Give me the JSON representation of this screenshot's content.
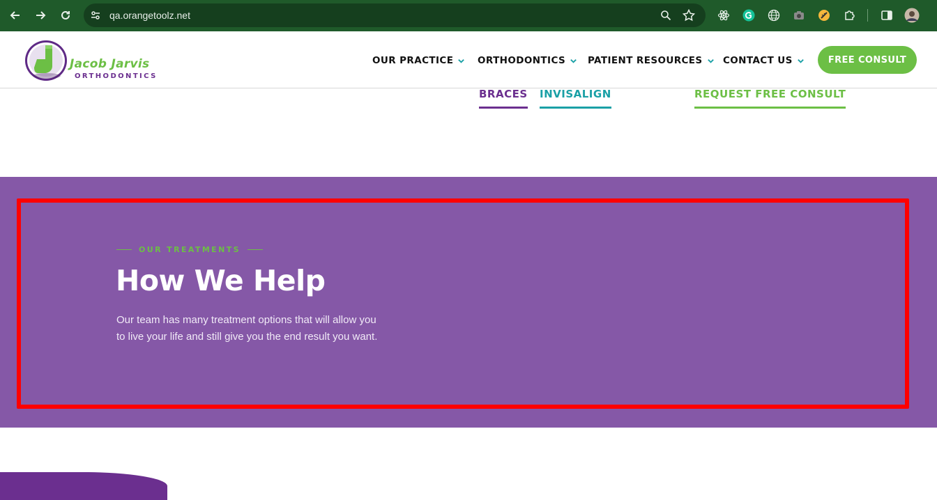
{
  "browser": {
    "url": "qa.orangetoolz.net",
    "icons": [
      "back-icon",
      "forward-icon",
      "reload-icon",
      "site-info-icon",
      "zoom-icon",
      "bookmark-star-icon",
      "react-devtools-icon",
      "grammarly-icon",
      "globe-extension-icon",
      "camera-extension-icon",
      "ruler-extension-icon",
      "puzzle-extensions-icon",
      "side-panel-icon",
      "profile-avatar"
    ]
  },
  "header": {
    "logo": {
      "name": "Jacob Jarvis",
      "subtitle": "ORTHODONTICS"
    },
    "menu": [
      {
        "label": "OUR PRACTICE"
      },
      {
        "label": "ORTHODONTICS"
      },
      {
        "label": "PATIENT RESOURCES"
      },
      {
        "label": "CONTACT US"
      }
    ],
    "cta": "FREE CONSULT"
  },
  "sublinks": [
    {
      "label": "BRACES",
      "color": "#6b2f8f"
    },
    {
      "label": "INVISALIGN",
      "color": "#1aa0a6"
    },
    {
      "label": "REQUEST FREE CONSULT",
      "color": "#6cbf45"
    }
  ],
  "treatments": {
    "eyebrow": "OUR TREATMENTS",
    "title": "How We Help",
    "body": "Our team has many treatment options that will allow you to live your life and still give you the end result you want."
  },
  "colors": {
    "brand_purple": "#8558a7",
    "brand_green": "#6cbf45",
    "highlight": "#ff0000"
  }
}
